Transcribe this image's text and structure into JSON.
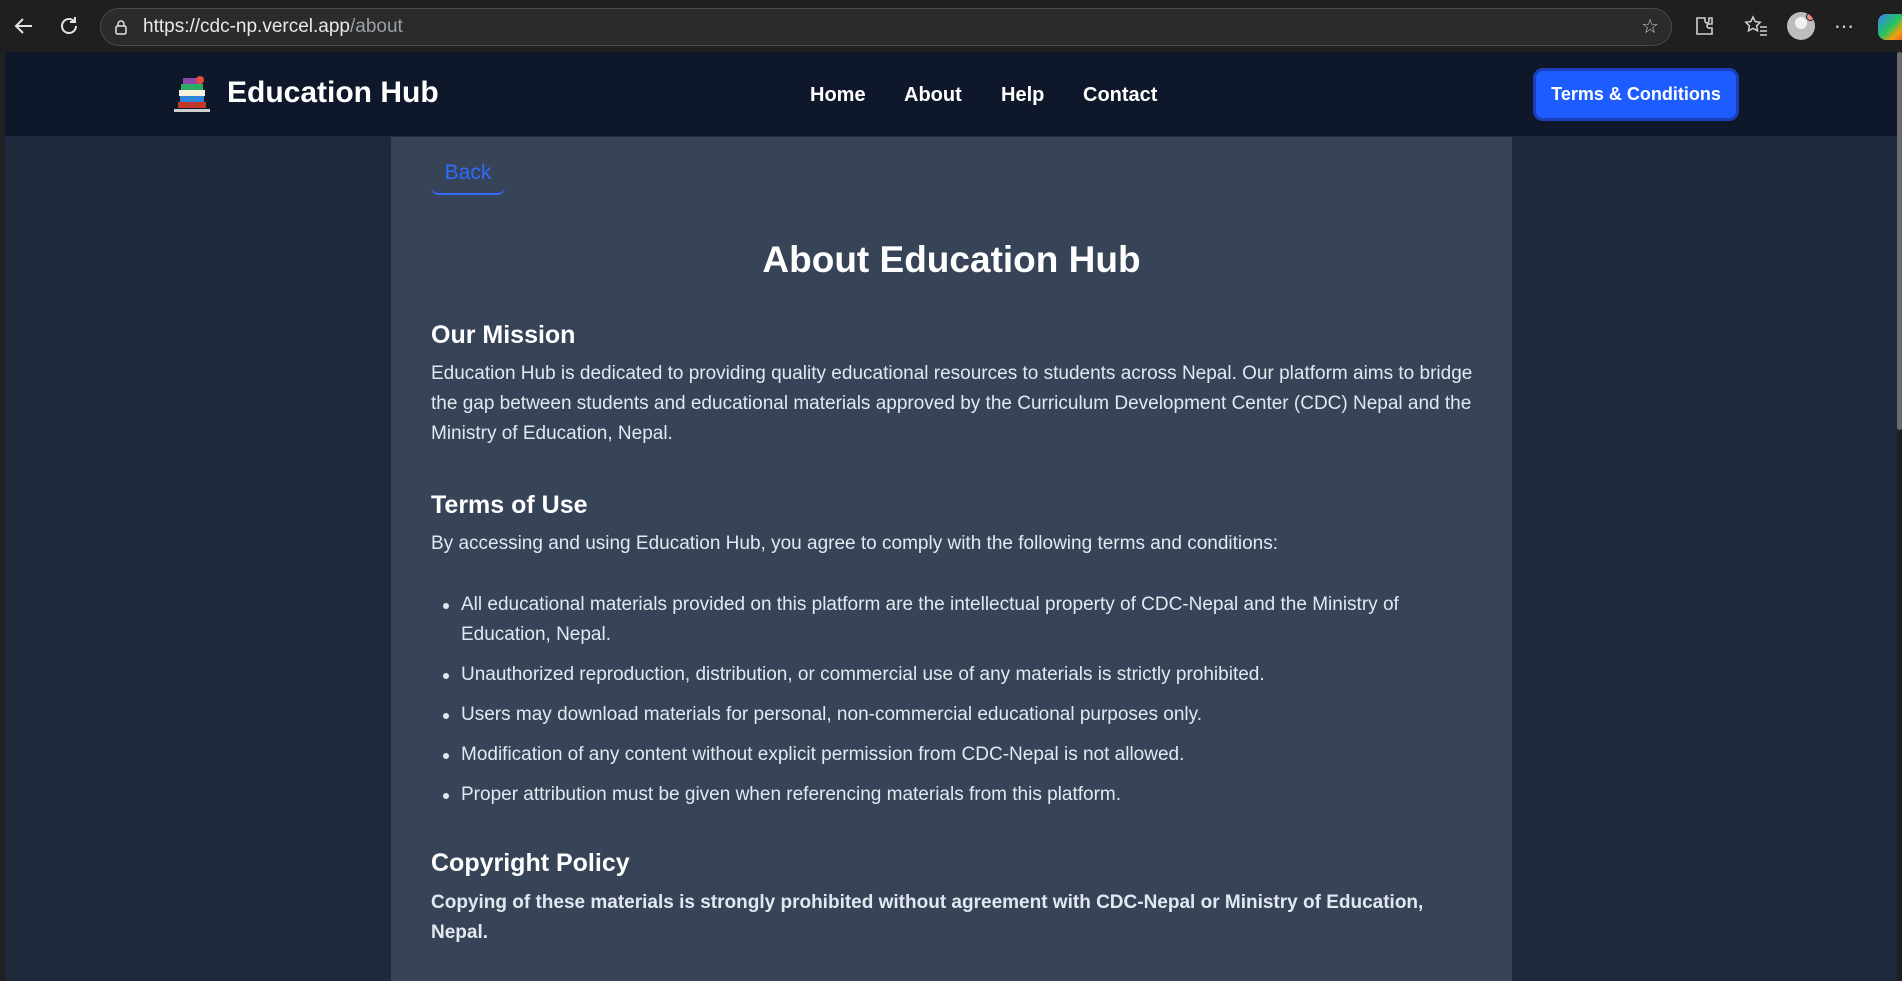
{
  "browser": {
    "url_host": "https://cdc-np.vercel.app",
    "url_path": "/about",
    "icons": [
      "back-arrow-icon",
      "reload-icon",
      "lock-icon",
      "star-icon",
      "extensions-icon",
      "favorites-icon",
      "profile-avatar",
      "more-icon",
      "copilot-icon"
    ]
  },
  "navbar": {
    "brand": "Education Hub",
    "links": [
      "Home",
      "About",
      "Help",
      "Contact"
    ],
    "cta": "Terms & Conditions"
  },
  "page": {
    "back_label": "Back",
    "title": "About Education Hub",
    "mission": {
      "heading": "Our Mission",
      "text": "Education Hub is dedicated to providing quality educational resources to students across Nepal. Our platform aims to bridge the gap between students and educational materials approved by the Curriculum Development Center (CDC) Nepal and the Ministry of Education, Nepal."
    },
    "terms": {
      "heading": "Terms of Use",
      "intro": "By accessing and using Education Hub, you agree to comply with the following terms and conditions:",
      "items": [
        "All educational materials provided on this platform are the intellectual property of CDC-Nepal and the Ministry of Education, Nepal.",
        "Unauthorized reproduction, distribution, or commercial use of any materials is strictly prohibited.",
        "Users may download materials for personal, non-commercial educational purposes only.",
        "Modification of any content without explicit permission from CDC-Nepal is not allowed.",
        "Proper attribution must be given when referencing materials from this platform."
      ]
    },
    "copyright": {
      "heading": "Copyright Policy",
      "text": "Copying of these materials is strongly prohibited without agreement with CDC-Nepal or Ministry of Education, Nepal."
    }
  },
  "colors": {
    "navbar_bg": "#0f172a",
    "page_bg": "#1e293b",
    "content_bg": "#374357",
    "accent": "#1d5cff"
  }
}
